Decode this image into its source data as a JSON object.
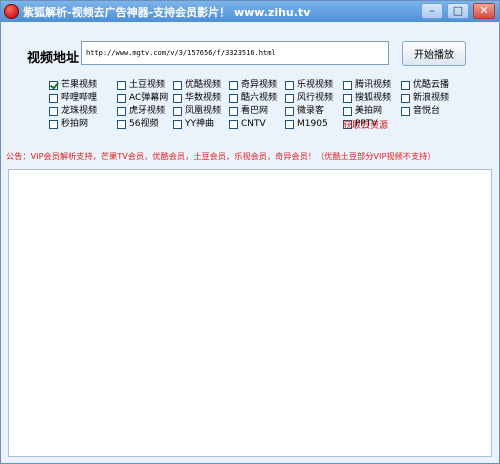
{
  "window": {
    "title": "紫狐解析-视频去广告神器-支持会员影片！ www.zihu.tv",
    "min_glyph": "–",
    "max_glyph": "□",
    "close_glyph": "✕"
  },
  "url": {
    "label": "视频地址",
    "value": "http://www.mgtv.com/v/3/157656/f/3323516.html"
  },
  "play_button": "开始播放",
  "platforms": [
    {
      "label": "芒果视频",
      "checked": true
    },
    {
      "label": "土豆视频",
      "checked": false
    },
    {
      "label": "优酷视频",
      "checked": false
    },
    {
      "label": "奇异视频",
      "checked": false
    },
    {
      "label": "乐视视频",
      "checked": false
    },
    {
      "label": "腾讯视频",
      "checked": false
    },
    {
      "label": "优酷云播",
      "checked": false
    },
    {
      "label": "哔哩哔哩",
      "checked": false
    },
    {
      "label": "AC弹幕网",
      "checked": false
    },
    {
      "label": "华数视频",
      "checked": false
    },
    {
      "label": "酷六视频",
      "checked": false
    },
    {
      "label": "风行视频",
      "checked": false
    },
    {
      "label": "搜狐视频",
      "checked": false
    },
    {
      "label": "新浪视频",
      "checked": false
    },
    {
      "label": "龙珠视频",
      "checked": false
    },
    {
      "label": "虎牙视频",
      "checked": false
    },
    {
      "label": "凤凰视频",
      "checked": false
    },
    {
      "label": "看巴网",
      "checked": false
    },
    {
      "label": "微录客",
      "checked": false
    },
    {
      "label": "美拍网",
      "checked": false
    },
    {
      "label": "音悦台",
      "checked": false
    },
    {
      "label": "秒拍网",
      "checked": false
    },
    {
      "label": "56视频",
      "checked": false
    },
    {
      "label": "YY神曲",
      "checked": false
    },
    {
      "label": "CNTV",
      "checked": false
    },
    {
      "label": "M1905",
      "checked": false
    },
    {
      "label": "PPTV",
      "checked": false
    }
  ],
  "cloud_link": "获取云资源",
  "notice": "公告：VIP会员解析支持，芒果TV会员，优酷会员，土豆会员，乐视会员，奇异会员！（优酷土豆部分VIP视频不支持）"
}
